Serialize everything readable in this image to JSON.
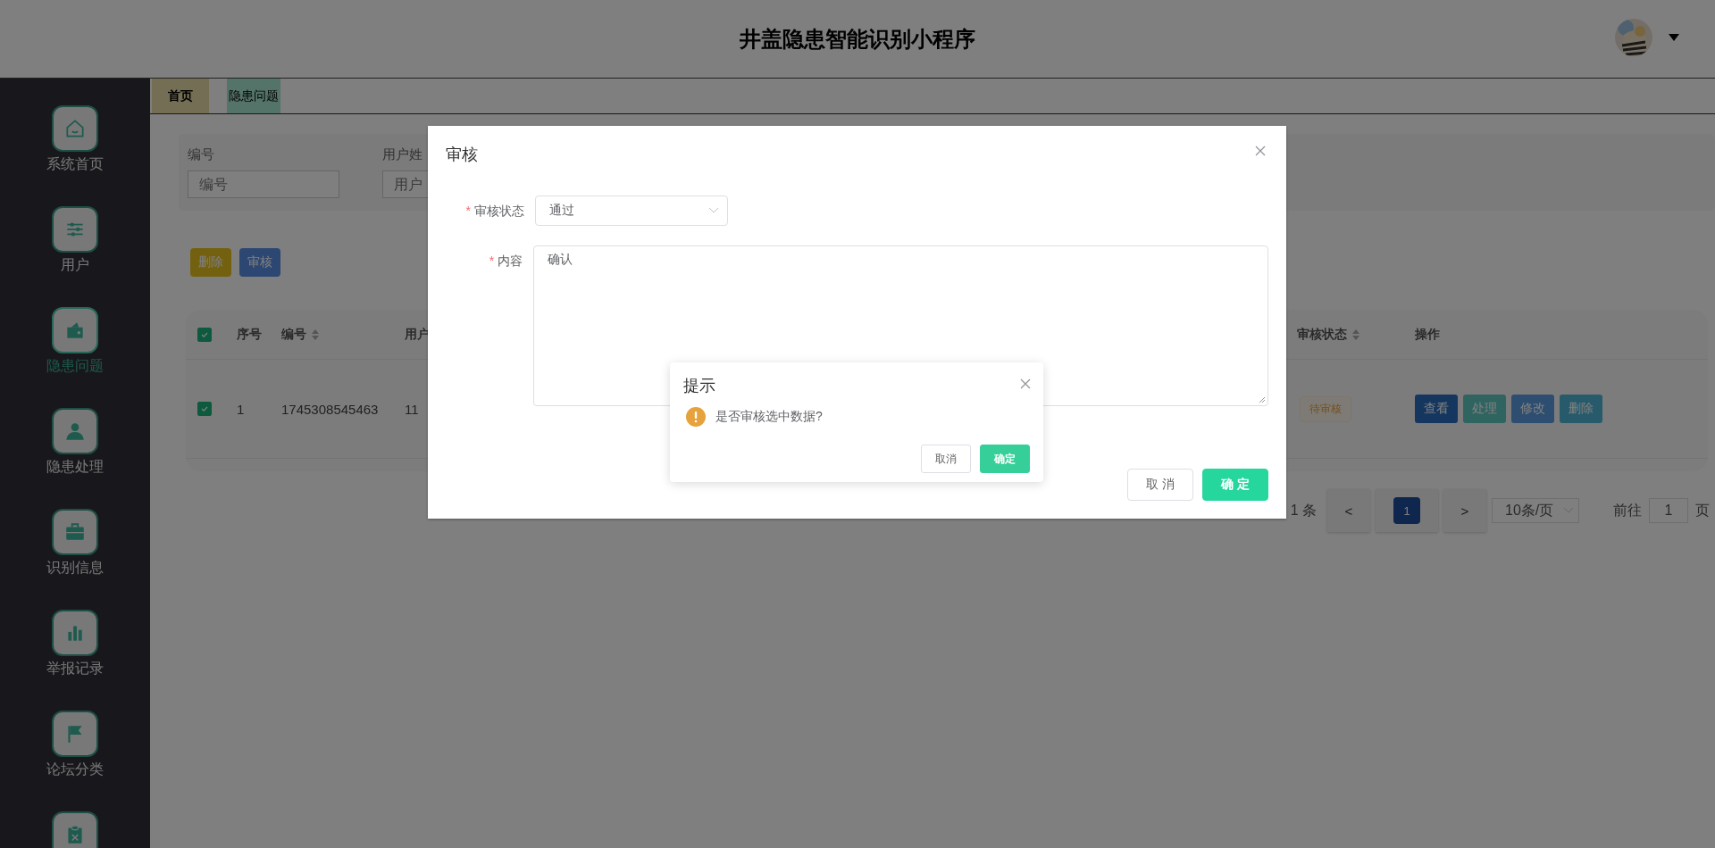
{
  "header": {
    "title": "井盖隐患智能识别小程序"
  },
  "sidebar": {
    "items": [
      {
        "label": "系统首页",
        "selected": false
      },
      {
        "label": "用户",
        "selected": false
      },
      {
        "label": "隐患问题",
        "selected": true
      },
      {
        "label": "隐患处理",
        "selected": false
      },
      {
        "label": "识别信息",
        "selected": false
      },
      {
        "label": "举报记录",
        "selected": false
      },
      {
        "label": "论坛分类",
        "selected": false
      },
      {
        "selected": false
      }
    ]
  },
  "tabs": [
    {
      "label": "首页",
      "selected": false
    },
    {
      "label": "隐患问题",
      "selected": true
    }
  ],
  "search": {
    "fields": [
      {
        "label": "编号",
        "placeholder": "编号"
      },
      {
        "label": "用户姓",
        "placeholder": "用户"
      }
    ]
  },
  "toolbar": {
    "buttons": [
      {
        "label": "删除",
        "kind": "danger"
      },
      {
        "label": "审核",
        "kind": "primary"
      }
    ]
  },
  "table": {
    "all_checked": true,
    "columns": [
      {
        "label": "序号",
        "sortable": false
      },
      {
        "label": "编号",
        "sortable": true
      },
      {
        "label": "用户"
      },
      {
        "label": "审核状态",
        "sortable": true
      },
      {
        "label": "操作",
        "sortable": false
      }
    ],
    "rows": [
      {
        "selected": true,
        "cells": [
          "1",
          "1745308545463",
          "11"
        ],
        "status": "待审核",
        "actions": [
          {
            "label": "查看",
            "kind": "view"
          },
          {
            "label": "处理",
            "kind": "handle"
          },
          {
            "label": "修改",
            "kind": "edit"
          },
          {
            "label": "删除",
            "kind": "delete"
          }
        ]
      }
    ]
  },
  "pagination": {
    "total": "1 条",
    "prev": "<",
    "pages": [
      {
        "label": "1",
        "selected": true
      }
    ],
    "next": ">",
    "page_size": "10条/页",
    "goto_label": "前往",
    "goto_value": "1",
    "page_label": "页"
  },
  "dialog": {
    "title": "审核",
    "fields": [
      {
        "kind": "select",
        "required_mark": "*",
        "label": "审核状态",
        "value": "通过"
      },
      {
        "kind": "textarea",
        "required_mark": "*",
        "label": "内容",
        "value": "确认"
      }
    ],
    "buttons": [
      {
        "label": "取 消",
        "kind": "default"
      },
      {
        "label": "确 定",
        "kind": "primary"
      }
    ]
  },
  "message_box": {
    "title": "提示",
    "message": "是否审核选中数据?",
    "buttons": [
      {
        "label": "取消",
        "kind": "default"
      },
      {
        "label": "确定",
        "kind": "primary"
      }
    ]
  }
}
